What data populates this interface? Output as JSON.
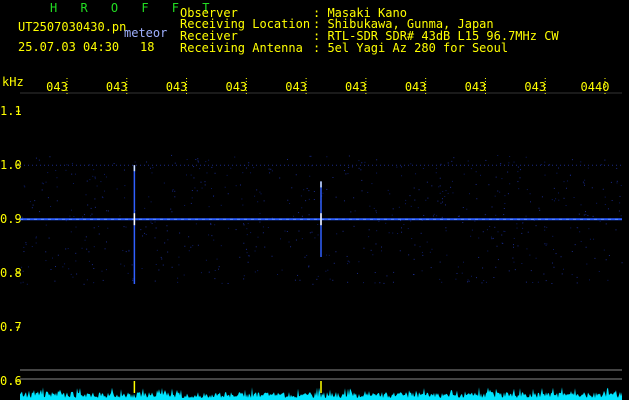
{
  "header": {
    "logo": "H R O F F T",
    "filename": "UT2507030430.pn",
    "type_label": "meteor",
    "datetime": "25.07.03 04:30",
    "count": "18",
    "rows": [
      {
        "label": "Observer",
        "value": ": Masaki Kano"
      },
      {
        "label": "Receiving Location",
        "value": ": Shibukawa, Gunma, Japan"
      },
      {
        "label": "Receiver",
        "value": ": RTL-SDR SDR# 43dB L15 96.7MHz CW"
      },
      {
        "label": "Receiving Antenna",
        "value": ": 5el Yagi Az 280 for Seoul"
      }
    ]
  },
  "colors": {
    "background": "#000000",
    "text": "#ffff00",
    "carrier": "#2a5cff",
    "noise_floor": "#00e5ff",
    "logo": "#22dd22"
  },
  "chart_data": {
    "type": "heatmap",
    "ylabel": "kHz",
    "ylim": [
      0.58,
      1.13
    ],
    "yticks": [
      {
        "value": 1.1,
        "label": "1.1"
      },
      {
        "value": 1.0,
        "label": "1.0"
      },
      {
        "value": 0.9,
        "label": "0.9"
      },
      {
        "value": 0.8,
        "label": "0.8"
      },
      {
        "value": 0.7,
        "label": "0.7"
      },
      {
        "value": 0.6,
        "label": "0.6"
      }
    ],
    "xticks": [
      "043",
      "043",
      "043",
      "043",
      "043",
      "043",
      "043",
      "043",
      "043",
      "0440"
    ],
    "carrier_khz": 0.9,
    "echoes": [
      {
        "x_minutes": 1.9,
        "f_low": 0.78,
        "f_high": 1.0
      },
      {
        "x_minutes": 5.0,
        "f_low": 0.83,
        "f_high": 0.97
      }
    ],
    "x_range_minutes": [
      0,
      10
    ]
  }
}
